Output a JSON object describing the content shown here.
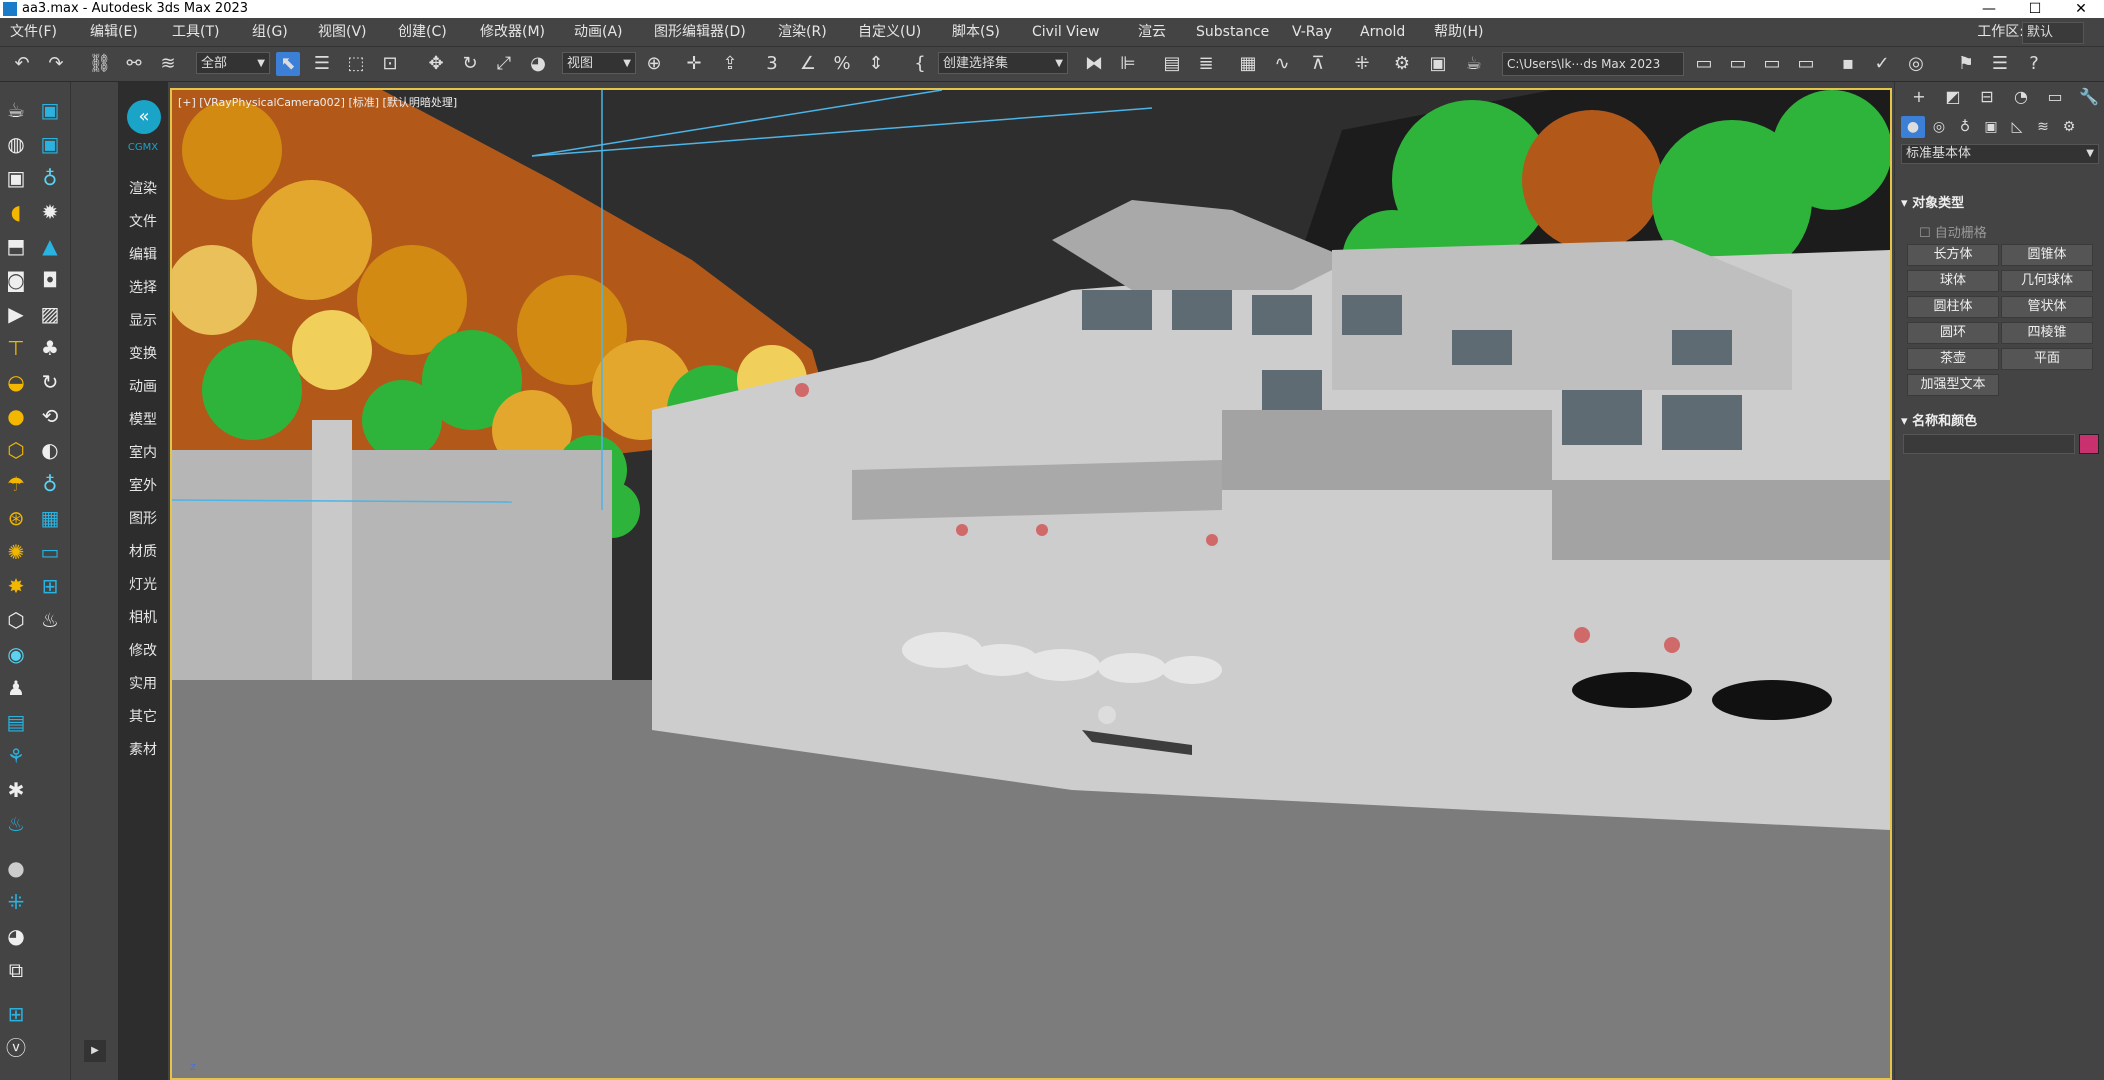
{
  "window": {
    "title": "aa3.max - Autodesk 3ds Max 2023",
    "controls": [
      "—",
      "☐",
      "✕"
    ]
  },
  "menu": {
    "items": [
      "文件(F)",
      "编辑(E)",
      "工具(T)",
      "组(G)",
      "视图(V)",
      "创建(C)",
      "修改器(M)",
      "动画(A)",
      "图形编辑器(D)",
      "渲染(R)",
      "自定义(U)",
      "脚本(S)",
      "Civil View",
      "渲云",
      "Substance",
      "V-Ray",
      "Arnold",
      "帮助(H)"
    ],
    "workspace_label": "工作区:",
    "workspace_value": "默认"
  },
  "toolbar": {
    "selection_filter": "全部",
    "ref_coord": "视图",
    "named_selection": "创建选择集",
    "project_path": "C:\\Users\\lk⋯ds Max 2023"
  },
  "command_panel": {
    "logo_text": "CGMX",
    "items": [
      "渲染",
      "文件",
      "编辑",
      "选择",
      "显示",
      "变换",
      "动画",
      "模型",
      "室内",
      "室外",
      "图形",
      "材质",
      "灯光",
      "相机",
      "修改",
      "实用",
      "其它",
      "素材"
    ]
  },
  "viewport": {
    "label": "[+] [VRayPhysicalCamera002] [标准] [默认明暗处理]",
    "axis_label": "z"
  },
  "create_panel": {
    "category_dropdown": "标准基本体",
    "object_type_title": "对象类型",
    "auto_grid": "自动栅格",
    "primitives": [
      "长方体",
      "圆锥体",
      "球体",
      "几何球体",
      "圆柱体",
      "管状体",
      "圆环",
      "四棱锥",
      "茶壶",
      "平面",
      "加强型文本"
    ],
    "name_color_title": "名称和颜色",
    "object_color": "#c8316e"
  },
  "colors": {
    "selection_blue": "#3c7fd6",
    "viewport_border": "#e5c44a"
  }
}
